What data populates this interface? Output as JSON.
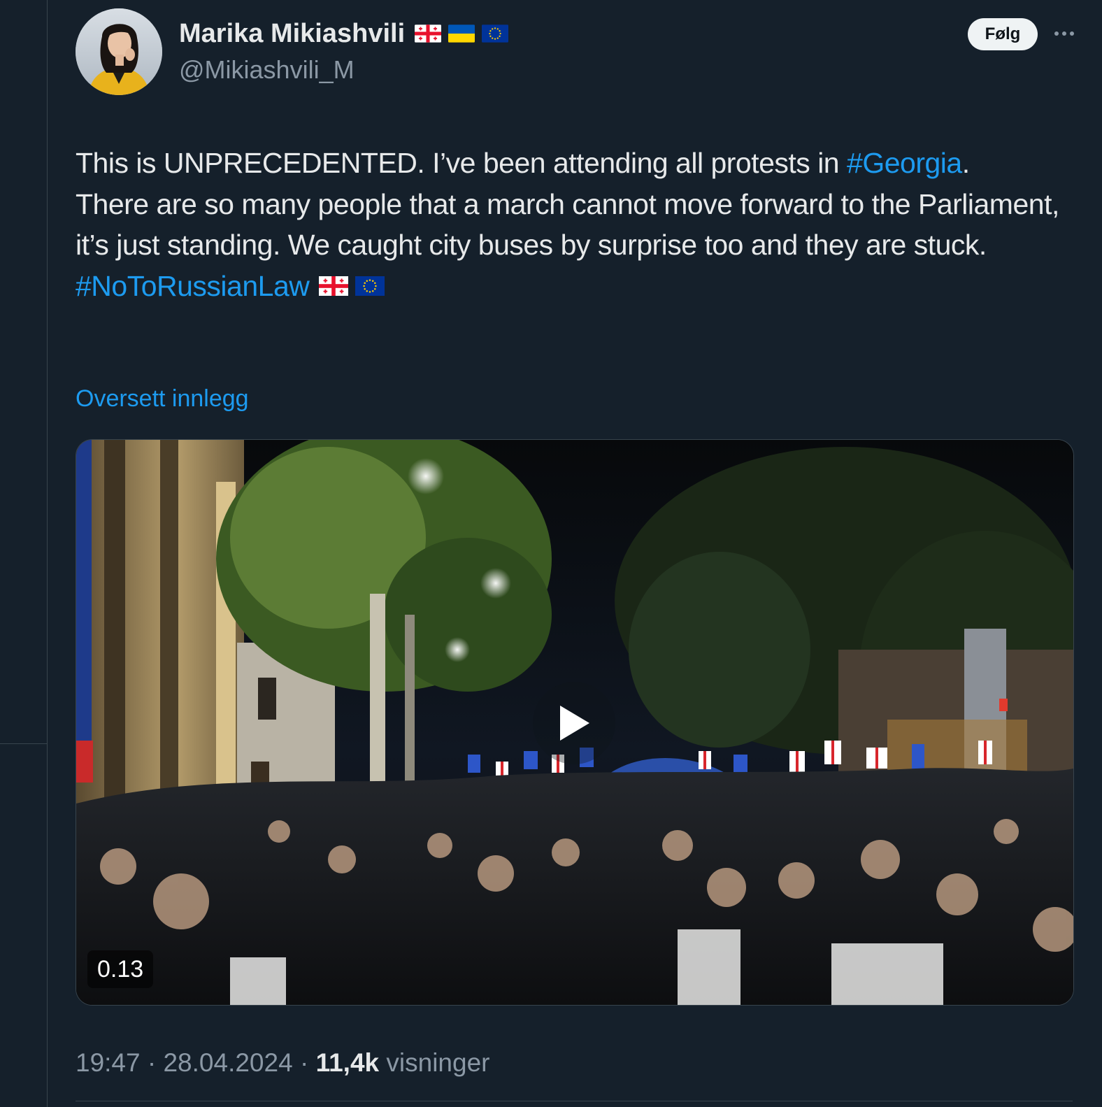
{
  "author": {
    "display_name": "Marika Mikiashvili",
    "handle": "@Mikiashvili_M",
    "flags": [
      "georgia-flag",
      "ukraine-flag",
      "eu-flag"
    ]
  },
  "actions": {
    "follow_label": "Følg",
    "more_icon": "more-horizontal-icon"
  },
  "tweet": {
    "line1_before": "This is UNPRECEDENTED. I’ve been attending all protests in ",
    "hashtag1": "#Georgia",
    "line1_after": ".",
    "body": "There are so many people that a march cannot move forward to the Parliament, it’s just standing. We caught city buses by surprise too and they are stuck.",
    "hashtag2": "#NoToRussianLaw",
    "trailing_flags": [
      "georgia-flag",
      "eu-flag"
    ]
  },
  "translate_label": "Oversett innlegg",
  "media": {
    "type": "video",
    "elapsed": "0.13",
    "play_icon": "play-icon"
  },
  "meta": {
    "time": "19:47",
    "separator": " · ",
    "date": "28.04.2024",
    "views_count": "11,4k",
    "views_label": "visninger"
  },
  "colors": {
    "background": "#15202b",
    "link": "#1d9bf0",
    "secondary_text": "#8b98a5",
    "border": "#38444d"
  }
}
